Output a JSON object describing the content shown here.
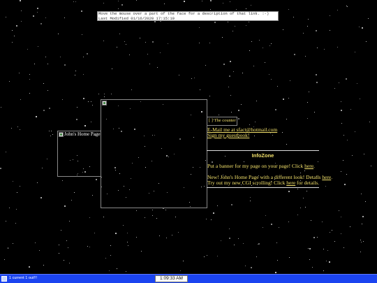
{
  "info_box": {
    "line1": "Move the mouse over a part of the face for a description of that link. :-)",
    "line2": "Last Modified 01/16/2020 17:15:10"
  },
  "left_image": {
    "alt": "John's Home Page"
  },
  "counter_image": {
    "alt": "[ ] The counter goes..."
  },
  "links": {
    "email": "E-Mail me at sfact@hotmail.com",
    "guestbook": "Sign my guestbook!"
  },
  "infozone": {
    "title": "InfoZone",
    "banner_text": "Put a banner for my page on your page! Click ",
    "banner_link": "here",
    "news1_text": "New! John's Home Page with a different look! Details ",
    "news1_link": "here",
    "news2_text": "Try out my new CGI scrolling! Click ",
    "news2_link": "here",
    "news2_tail": " for details."
  },
  "statusbar": {
    "text": "1 current 1 out!!!",
    "clock": "1:09:33 AM"
  },
  "colors": {
    "background": "#000000",
    "link_yellow": "#f2e06a",
    "statusbar_blue": "#1b44f0"
  }
}
